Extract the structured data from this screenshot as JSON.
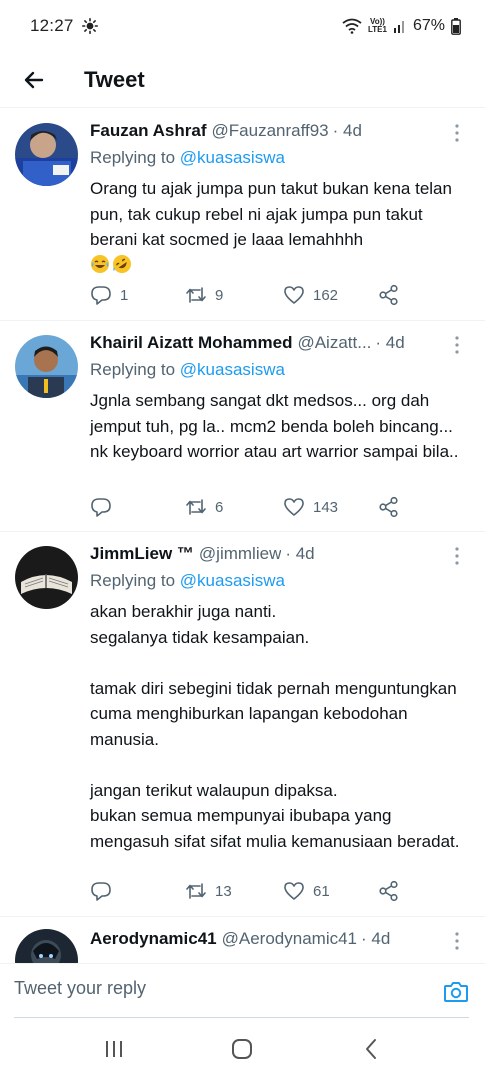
{
  "status_bar": {
    "time": "12:27",
    "volte_top": "Vo))",
    "volte_bottom": "LTE1",
    "battery": "67%"
  },
  "header": {
    "title": "Tweet"
  },
  "tweets": [
    {
      "name": "Fauzan Ashraf",
      "handle": "@Fauzanraff93",
      "time": "· 4d",
      "replying_prefix": "Replying to",
      "replying_to": "@kuasasiswa",
      "text": "Orang tu ajak jumpa pun takut bukan kena telan pun, tak cukup rebel ni ajak jumpa pun takut berani kat socmed je laaa lemahhhh",
      "emojis": [
        "face-with-tears-of-joy",
        "rolling-on-floor-laughing"
      ],
      "replies": "1",
      "retweets": "9",
      "likes": "162"
    },
    {
      "name": "Khairil Aizatt Mohammed",
      "handle": "@Aizatt...",
      "time": "· 4d",
      "replying_prefix": "Replying to",
      "replying_to": "@kuasasiswa",
      "text": "Jgnla sembang sangat dkt medsos... org dah jemput tuh, pg la.. mcm2 benda boleh bincang... nk keyboard worrior atau art warrior sampai bila..",
      "replies": "",
      "retweets": "6",
      "likes": "143"
    },
    {
      "name": "JimmLiew ™",
      "handle": "@jimmliew",
      "time": "· 4d",
      "replying_prefix": "Replying to",
      "replying_to": "@kuasasiswa",
      "text": "akan berakhir juga nanti.\nsegalanya tidak kesampaian.\n\ntamak diri sebegini tidak pernah menguntungkan cuma menghiburkan lapangan kebodohan manusia.\n\njangan terikut walaupun dipaksa.\nbukan semua mempunyai ibubapa yang mengasuh sifat sifat mulia kemanusiaan beradat.",
      "replies": "",
      "retweets": "13",
      "likes": "61"
    },
    {
      "name": "Aerodynamic41",
      "handle": "@Aerodynamic41",
      "time": "· 4d"
    }
  ],
  "reply_bar": {
    "placeholder": "Tweet your reply"
  },
  "colors": {
    "accent": "#1d9bf0",
    "secondary_text": "#536471",
    "divider": "#eff3f4"
  }
}
